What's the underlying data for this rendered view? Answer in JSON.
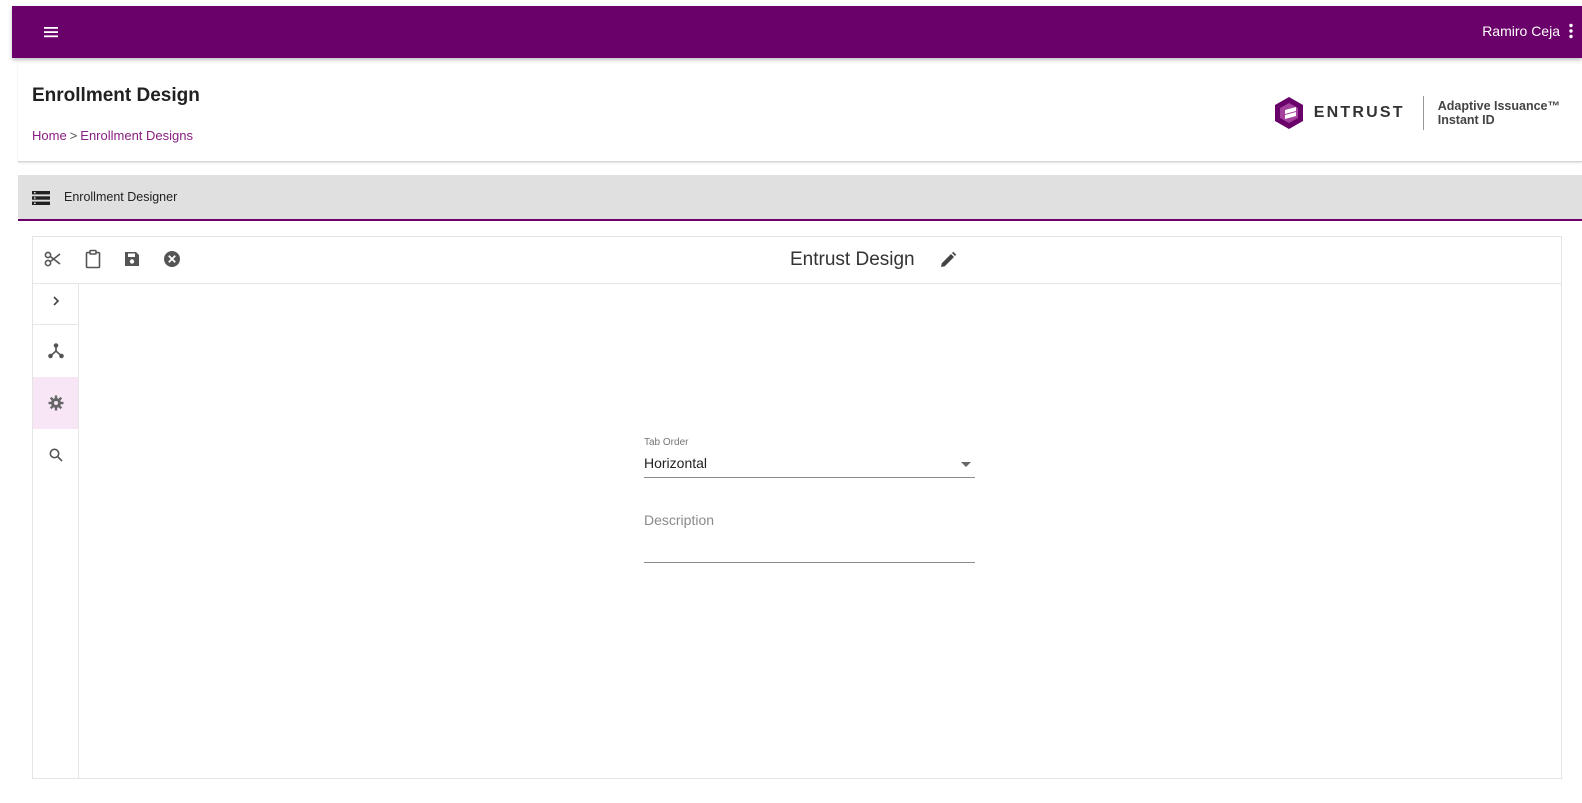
{
  "topbar": {
    "menu_icon": "hamburger-menu-icon",
    "user_name": "Ramiro Ceja",
    "user_menu_icon": "kebab-menu-icon",
    "color": "#6a0069"
  },
  "header": {
    "title": "Enrollment Design",
    "breadcrumb": {
      "home": "Home",
      "separator": ">",
      "current": "Enrollment Designs"
    },
    "logo": {
      "brand": "ENTRUST",
      "product_line1": "Adaptive Issuance™",
      "product_line2": "Instant ID"
    }
  },
  "section": {
    "icon": "list-icon",
    "title": "Enrollment Designer"
  },
  "designer": {
    "toolbar": {
      "tools": [
        "scissors-icon",
        "clipboard-icon",
        "save-icon",
        "cancel-circle-icon"
      ],
      "design_name": "Entrust Design",
      "edit_icon": "pencil-icon"
    },
    "rail": {
      "items": [
        "chevron-right-icon",
        "hierarchy-icon",
        "settings-gear-icon",
        "search-icon"
      ],
      "active_index": 2
    },
    "form": {
      "tab_order": {
        "label": "Tab Order",
        "value": "Horizontal"
      },
      "description": {
        "placeholder": "Description"
      }
    }
  }
}
